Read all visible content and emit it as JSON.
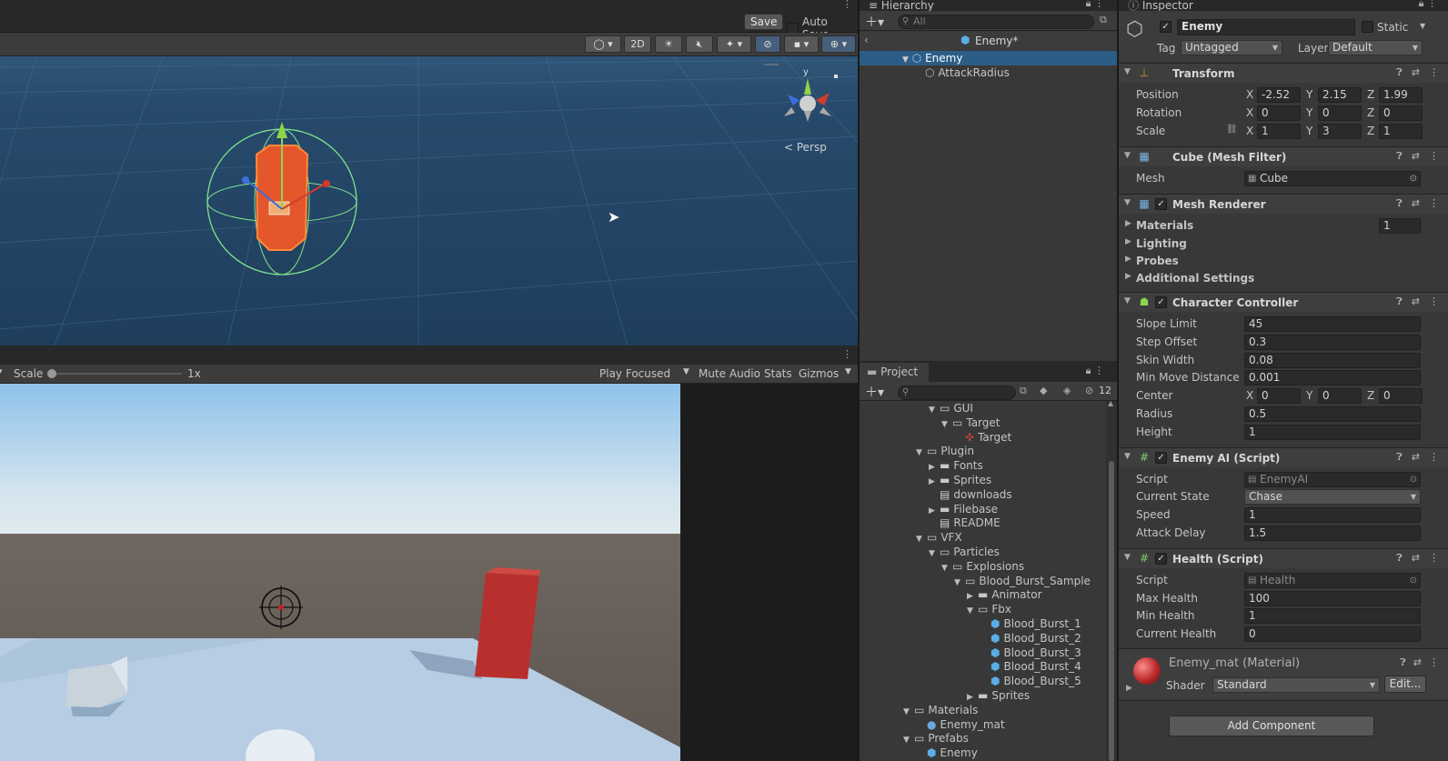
{
  "toolbar": {
    "save_label": "Save",
    "autosave_label": "Auto Save"
  },
  "scene_tools": {
    "mode_2d": "2D",
    "persp_label": "< Persp",
    "gizmo_axis_y": "y"
  },
  "game_toolbar": {
    "scale_label": "Scale",
    "scale_value": "1x",
    "play_focused": "Play Focused",
    "mute_audio": "Mute Audio",
    "stats": "Stats",
    "gizmos": "Gizmos"
  },
  "hierarchy": {
    "title": "Hierarchy",
    "search_placeholder": "All",
    "prefab_name": "Enemy*",
    "items": [
      {
        "label": "Enemy",
        "selected": true
      },
      {
        "label": "AttackRadius",
        "selected": false
      }
    ]
  },
  "project": {
    "title": "Project",
    "hidden_count": "12",
    "tree": [
      {
        "label": "GUI",
        "depth": 0,
        "type": "folder-open"
      },
      {
        "label": "Target",
        "depth": 1,
        "type": "folder-open"
      },
      {
        "label": "Target",
        "depth": 2,
        "type": "asset"
      },
      {
        "label": "Plugin",
        "depth": -1,
        "type": "folder-open"
      },
      {
        "label": "Fonts",
        "depth": 0,
        "type": "folder-closed"
      },
      {
        "label": "Sprites",
        "depth": 0,
        "type": "folder-closed"
      },
      {
        "label": "downloads",
        "depth": 0,
        "type": "file"
      },
      {
        "label": "Filebase",
        "depth": 0,
        "type": "folder-closed"
      },
      {
        "label": "README",
        "depth": 0,
        "type": "file"
      },
      {
        "label": "VFX",
        "depth": -1,
        "type": "folder-open"
      },
      {
        "label": "Particles",
        "depth": 0,
        "type": "folder-open"
      },
      {
        "label": "Explosions",
        "depth": 1,
        "type": "folder-open"
      },
      {
        "label": "Blood_Burst_Sample",
        "depth": 2,
        "type": "folder-open"
      },
      {
        "label": "Animator",
        "depth": 3,
        "type": "folder-closed"
      },
      {
        "label": "Fbx",
        "depth": 3,
        "type": "folder-open"
      },
      {
        "label": "Blood_Burst_1",
        "depth": 4,
        "type": "prefab"
      },
      {
        "label": "Blood_Burst_2",
        "depth": 4,
        "type": "prefab"
      },
      {
        "label": "Blood_Burst_3",
        "depth": 4,
        "type": "prefab"
      },
      {
        "label": "Blood_Burst_4",
        "depth": 4,
        "type": "prefab"
      },
      {
        "label": "Blood_Burst_5",
        "depth": 4,
        "type": "prefab"
      },
      {
        "label": "Sprites",
        "depth": 3,
        "type": "folder-closed"
      },
      {
        "label": "Materials",
        "depth": -2,
        "type": "folder-open"
      },
      {
        "label": "Enemy_mat",
        "depth": -1,
        "type": "material"
      },
      {
        "label": "Prefabs",
        "depth": -2,
        "type": "folder-open"
      },
      {
        "label": "Enemy",
        "depth": -1,
        "type": "prefab"
      }
    ]
  },
  "inspector": {
    "title": "Inspector",
    "object_name": "Enemy",
    "static_label": "Static",
    "tag_label": "Tag",
    "tag_value": "Untagged",
    "layer_label": "Layer",
    "layer_value": "Default",
    "transform": {
      "title": "Transform",
      "position_label": "Position",
      "position": [
        "-2.52",
        "2.15",
        "1.99"
      ],
      "rotation_label": "Rotation",
      "rotation": [
        "0",
        "0",
        "0"
      ],
      "scale_label": "Scale",
      "scale": [
        "1",
        "3",
        "1"
      ]
    },
    "mesh_filter": {
      "title": "Cube (Mesh Filter)",
      "mesh_label": "Mesh",
      "mesh_value": "Cube"
    },
    "mesh_renderer": {
      "title": "Mesh Renderer",
      "materials": "Materials",
      "materials_count": "1",
      "lighting": "Lighting",
      "probes": "Probes",
      "additional": "Additional Settings"
    },
    "character_controller": {
      "title": "Character Controller",
      "slope_limit_label": "Slope Limit",
      "slope_limit": "45",
      "step_offset_label": "Step Offset",
      "step_offset": "0.3",
      "skin_width_label": "Skin Width",
      "skin_width": "0.08",
      "min_move_label": "Min Move Distance",
      "min_move": "0.001",
      "center_label": "Center",
      "center": [
        "0",
        "0",
        "0"
      ],
      "radius_label": "Radius",
      "radius": "0.5",
      "height_label": "Height",
      "height": "1"
    },
    "enemy_ai": {
      "title": "Enemy AI (Script)",
      "script_label": "Script",
      "script_value": "EnemyAI",
      "state_label": "Current State",
      "state_value": "Chase",
      "speed_label": "Speed",
      "speed_value": "1",
      "delay_label": "Attack Delay",
      "delay_value": "1.5"
    },
    "health": {
      "title": "Health (Script)",
      "script_label": "Script",
      "script_value": "Health",
      "max_label": "Max Health",
      "max_value": "100",
      "min_label": "Min Health",
      "min_value": "1",
      "current_label": "Current Health",
      "current_value": "0"
    },
    "material": {
      "title": "Enemy_mat (Material)",
      "shader_label": "Shader",
      "shader_value": "Standard",
      "edit_label": "Edit..."
    },
    "add_component": "Add Component"
  },
  "axes": {
    "x": "X",
    "y": "Y",
    "z": "Z"
  },
  "colors": {
    "selection": "#2c5d87",
    "accent_blue": "#46607c",
    "enemy_red": "#b83a3a"
  }
}
